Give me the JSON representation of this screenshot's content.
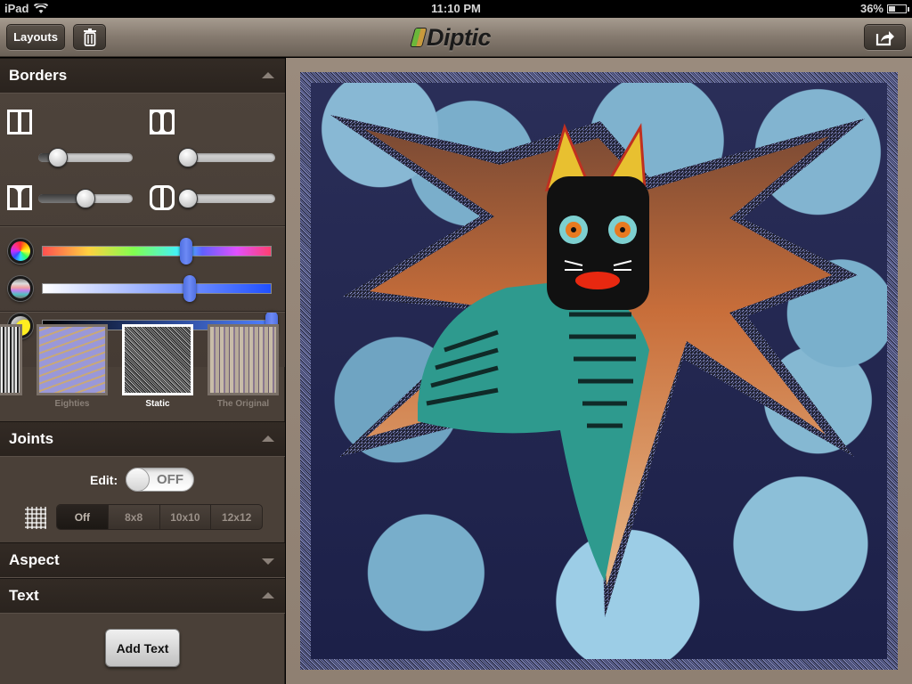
{
  "status_bar": {
    "device": "iPad",
    "time": "11:10 PM",
    "battery": "36%",
    "battery_level": 0.36
  },
  "toolbar": {
    "layouts_label": "Layouts",
    "logo_text": "Diptic",
    "trash_icon": "trash-icon",
    "share_icon": "share-icon"
  },
  "borders": {
    "title": "Borders",
    "expanded": true,
    "sliders": [
      {
        "name": "inner-border-width",
        "icon": "inner-border-icon",
        "value": 0.1
      },
      {
        "name": "outer-border-width",
        "icon": "outer-border-icon",
        "value": 0.0
      },
      {
        "name": "border-curve",
        "icon": "curve-border-icon",
        "value": 0.5
      },
      {
        "name": "corner-radius",
        "icon": "corner-radius-icon",
        "value": 0.0
      }
    ],
    "color_sliders": [
      {
        "name": "hue",
        "icon": "hue-wheel-icon",
        "value": 0.65
      },
      {
        "name": "saturation",
        "icon": "saturation-icon",
        "value": 0.67
      },
      {
        "name": "brightness",
        "icon": "brightness-icon",
        "value": 1.0
      }
    ],
    "textures": [
      {
        "label": "",
        "selected": false
      },
      {
        "label": "Eighties",
        "selected": false
      },
      {
        "label": "Static",
        "selected": true
      },
      {
        "label": "The Original",
        "selected": false
      }
    ]
  },
  "joints": {
    "title": "Joints",
    "expanded": true,
    "edit_label": "Edit:",
    "edit_toggle": "OFF",
    "grid_options": [
      "Off",
      "8x8",
      "10x10",
      "12x12"
    ],
    "grid_selected": "Off"
  },
  "aspect": {
    "title": "Aspect",
    "expanded": false
  },
  "text": {
    "title": "Text",
    "expanded": true,
    "add_label": "Add Text"
  }
}
